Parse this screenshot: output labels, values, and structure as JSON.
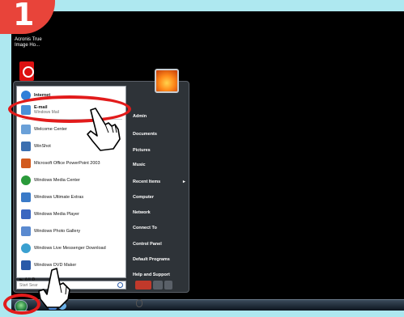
{
  "step_number": "1",
  "desktop": {
    "icons": [
      {
        "name": "Acronis True Image Ho...",
        "label_line1": "Acronis True",
        "label_line2": "Image Ho..."
      }
    ]
  },
  "start_menu": {
    "pinned": [
      {
        "title": "Internet",
        "subtitle": "",
        "icon": "internet-explorer-icon",
        "color": "#2f7fd8"
      },
      {
        "title": "E-mail",
        "subtitle": "Windows Mail",
        "icon": "mail-icon",
        "color": "#4a90d9"
      }
    ],
    "recent": [
      {
        "title": "Welcome Center",
        "icon": "welcome-center-icon",
        "color": "#6aa0d8"
      },
      {
        "title": "WinShot",
        "icon": "winshot-icon",
        "color": "#3c6fb0"
      },
      {
        "title": "Microsoft Office PowerPoint 2003",
        "icon": "powerpoint-icon",
        "color": "#d25a1e"
      },
      {
        "title": "Windows Media Center",
        "icon": "media-center-icon",
        "color": "#2a9a3a"
      },
      {
        "title": "Windows Ultimate Extras",
        "icon": "ultimate-extras-icon",
        "color": "#3a7ac8"
      },
      {
        "title": "Windows Media Player",
        "icon": "media-player-icon",
        "color": "#3a66c0"
      },
      {
        "title": "Windows Photo Gallery",
        "icon": "photo-gallery-icon",
        "color": "#5a8ad0"
      },
      {
        "title": "Windows Live Messenger Download",
        "icon": "messenger-icon",
        "color": "#3aa0d0"
      },
      {
        "title": "Windows DVD Maker",
        "icon": "dvd-maker-icon",
        "color": "#2a5aa8"
      }
    ],
    "all_programs": "All P",
    "search_placeholder": "Start Sear",
    "right_items": [
      "Admin",
      "Documents",
      "Pictures",
      "Music",
      "Recent Items",
      "Computer",
      "Network",
      "Connect To",
      "Control Panel",
      "Default Programs",
      "Help and Support"
    ],
    "recent_items_arrow": "▸"
  },
  "colors": {
    "highlight": "#e21b1b",
    "frame": "#aee8f0",
    "badge": "#e8443a"
  }
}
